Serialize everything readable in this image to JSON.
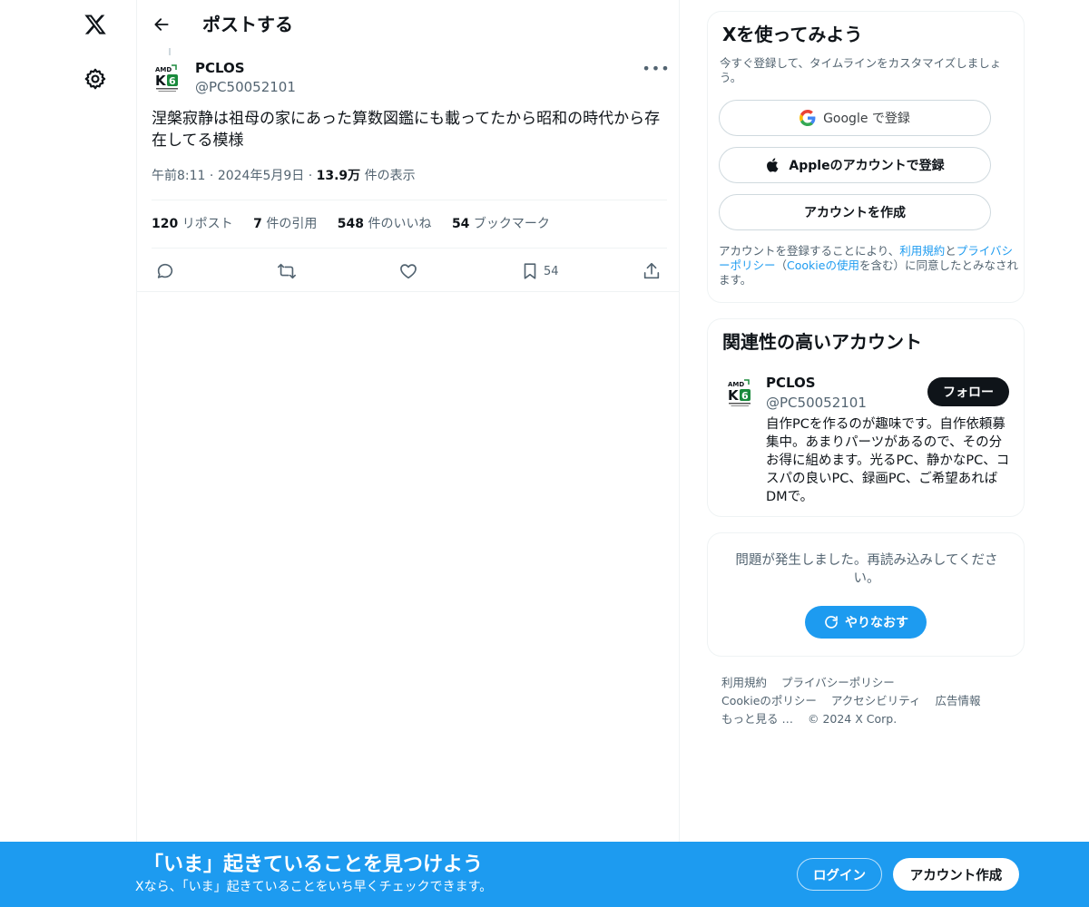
{
  "nav": {
    "logo_icon": "x-logo-icon",
    "settings_icon": "gear-icon"
  },
  "header": {
    "title": "ポストする"
  },
  "post": {
    "author_name": "PCLOS",
    "author_handle": "@PC50052101",
    "avatar_text": "AMD K6",
    "text": "涅槃寂静は祖母の家にあった算数図鑑にも載ってたから昭和の時代から存在してる模様",
    "time": "午前8:11",
    "date": "2024年5月9日",
    "views_count": "13.9万",
    "views_label": "件の表示",
    "stats": [
      {
        "count": "120",
        "label": "リポスト"
      },
      {
        "count": "7",
        "label": "件の引用"
      },
      {
        "count": "548",
        "label": "件のいいね"
      },
      {
        "count": "54",
        "label": "ブックマーク"
      }
    ],
    "bookmark_count": "54"
  },
  "signup_card": {
    "title": "Xを使ってみよう",
    "subtitle": "今すぐ登録して、タイムラインをカスタマイズしましょう。",
    "google_label": "Google で登録",
    "apple_label": "Appleのアカウントで登録",
    "create_label": "アカウントを作成",
    "legal_pre": "アカウントを登録することにより、",
    "legal_terms": "利用規約",
    "legal_and": "と",
    "legal_privacy": "プライバシーポリシー",
    "legal_paren_open": "（",
    "legal_cookie": "Cookieの使用",
    "legal_post": "を含む）に同意したとみなされます。"
  },
  "related": {
    "title": "関連性の高いアカウント",
    "name": "PCLOS",
    "handle": "@PC50052101",
    "follow_label": "フォロー",
    "bio": "自作PCを作るのが趣味です。自作依頼募集中。あまりパーツがあるので、その分お得に組めます。光るPC、静かなPC、コスパの良いPC、録画PC、ご希望あればDMで。"
  },
  "error_card": {
    "text": "問題が発生しました。再読み込みしてください。",
    "retry_label": "やりなおす"
  },
  "footer": {
    "links_row1": [
      "利用規約",
      "プライバシーポリシー"
    ],
    "links_row2": [
      "Cookieのポリシー",
      "アクセシビリティ",
      "広告情報"
    ],
    "more": "もっと見る …",
    "copyright": "© 2024 X Corp."
  },
  "bottom_bar": {
    "title": "「いま」起きていることを見つけよう",
    "subtitle": "Xなら、「いま」起きていることをいち早くチェックできます。",
    "login_label": "ログイン",
    "signup_label": "アカウント作成"
  },
  "colors": {
    "brand_blue": "#1d9bf0",
    "text_primary": "#0f1419",
    "text_secondary": "#536471",
    "border": "#eff3f4"
  }
}
